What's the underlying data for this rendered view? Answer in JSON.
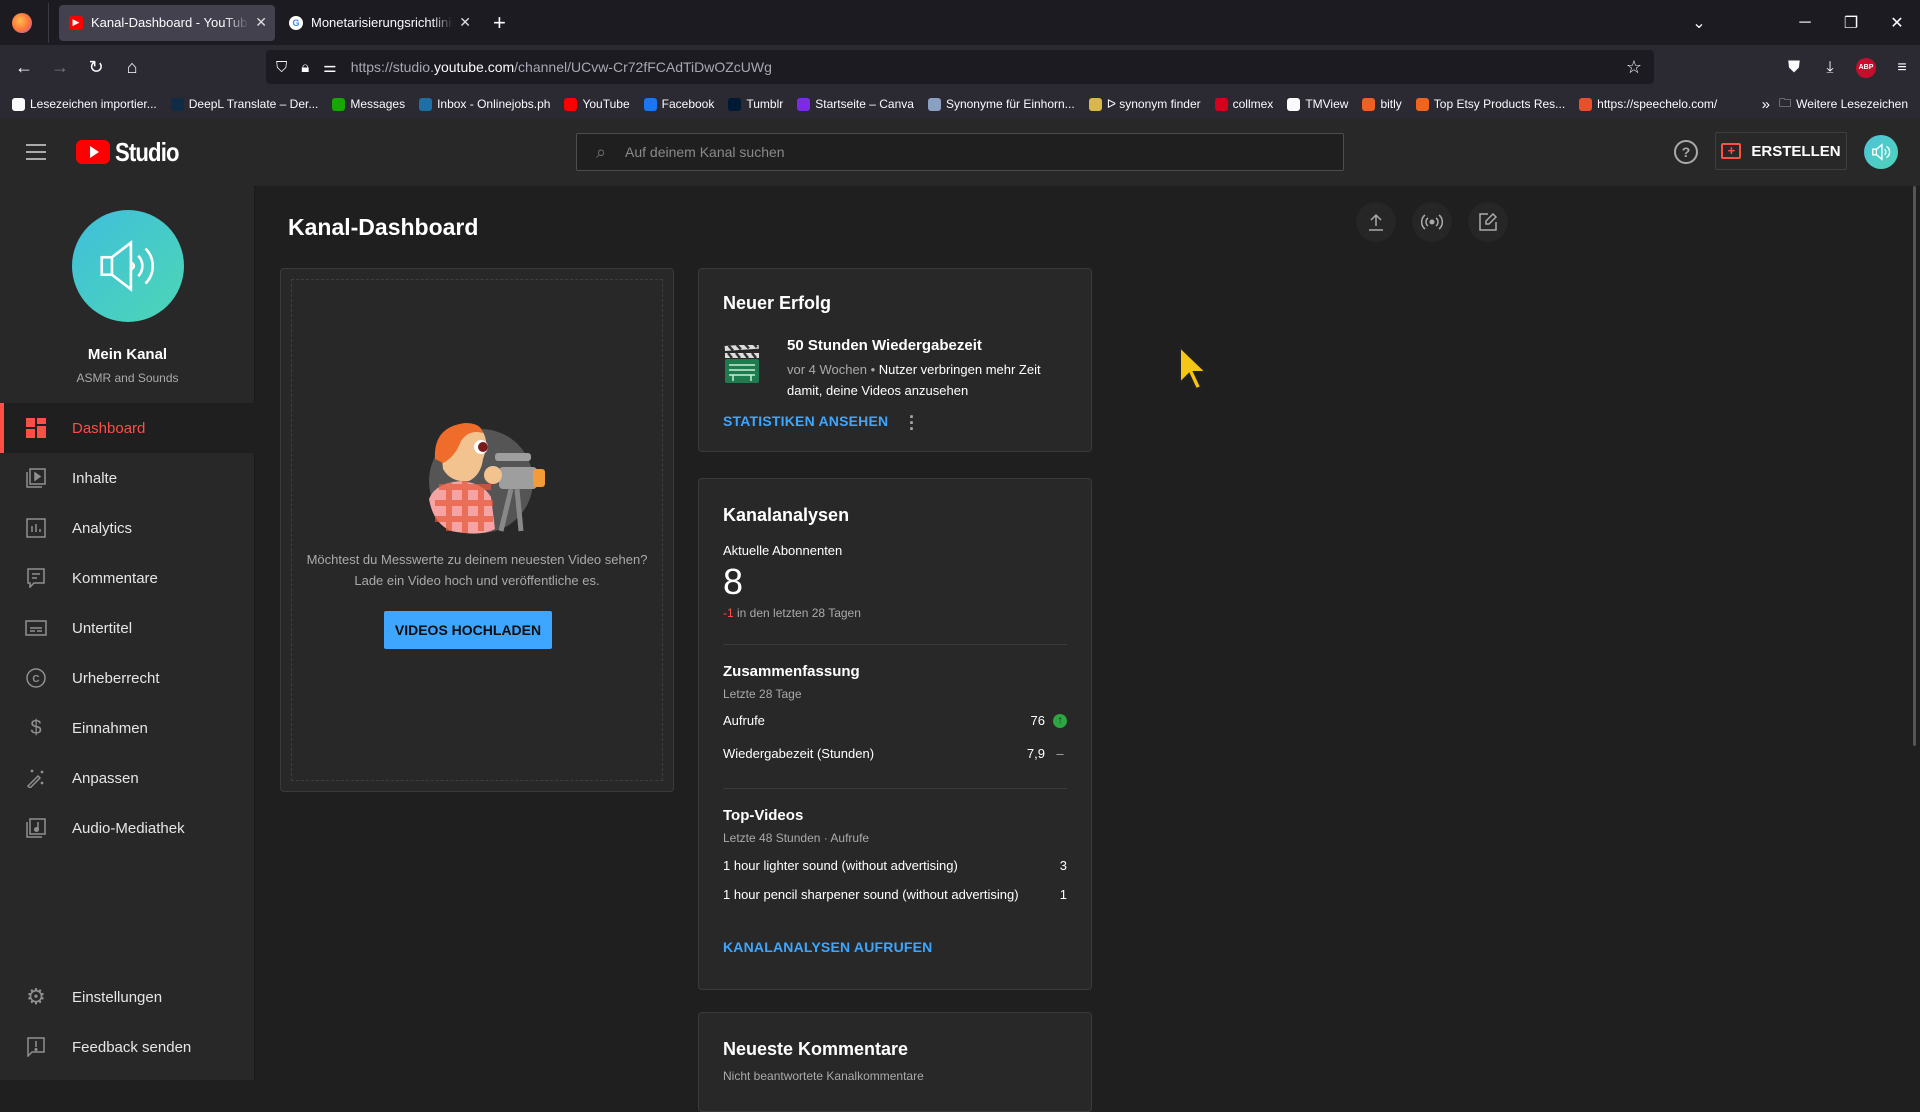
{
  "browser": {
    "tabs": [
      {
        "title": "Kanal-Dashboard - YouTube Studio",
        "favicon": "youtube-icon",
        "active": true
      },
      {
        "title": "Monetarisierungsrichtlinien von YouTube",
        "favicon": "google-icon",
        "active": false
      }
    ],
    "url": {
      "prefix": "https://studio.",
      "domain": "youtube.com",
      "path": "/channel/UCvw-Cr72fFCAdTiDwOZcUWg"
    },
    "bookmarks": [
      {
        "label": "Lesezeichen importier...",
        "icon": "import-icon",
        "color": "#fbfbfe"
      },
      {
        "label": "DeepL Translate – Der...",
        "icon": "deepl-icon",
        "color": "#0f2b46"
      },
      {
        "label": "Messages",
        "icon": "upwork-icon",
        "color": "#14a800"
      },
      {
        "label": "Inbox - Onlinejobs.ph",
        "icon": "onlinejobs-icon",
        "color": "#1d6fa5"
      },
      {
        "label": "YouTube",
        "icon": "youtube-icon",
        "color": "#ff0000"
      },
      {
        "label": "Facebook",
        "icon": "facebook-icon",
        "color": "#1877f2"
      },
      {
        "label": "Tumblr",
        "icon": "tumblr-icon",
        "color": "#001935"
      },
      {
        "label": "Startseite – Canva",
        "icon": "canva-icon",
        "color": "#7d2ae8"
      },
      {
        "label": "Synonyme für Einhorn...",
        "icon": "synonyme-icon",
        "color": "#8aa0c0"
      },
      {
        "label": "ᐅ synonym finder",
        "icon": "synonym-finder-icon",
        "color": "#d8b84a"
      },
      {
        "label": "collmex",
        "icon": "collmex-icon",
        "color": "#d6001c"
      },
      {
        "label": "TMView",
        "icon": "globe-icon",
        "color": "#fbfbfe"
      },
      {
        "label": "bitly",
        "icon": "bitly-icon",
        "color": "#ee6123"
      },
      {
        "label": "Top Etsy Products Res...",
        "icon": "etsy-icon",
        "color": "#f1641e"
      },
      {
        "label": "https://speechelo.com/",
        "icon": "speechelo-icon",
        "color": "#e8502a"
      }
    ],
    "more_bookmarks": "Weitere Lesezeichen"
  },
  "header": {
    "logo_text": "Studio",
    "search_placeholder": "Auf deinem Kanal suchen",
    "create_label": "ERSTELLEN"
  },
  "sidebar": {
    "channel_name": "Mein Kanal",
    "channel_subtitle": "ASMR and Sounds",
    "items": [
      {
        "label": "Dashboard",
        "icon": "dashboard-icon",
        "active": true
      },
      {
        "label": "Inhalte",
        "icon": "content-icon"
      },
      {
        "label": "Analytics",
        "icon": "analytics-icon"
      },
      {
        "label": "Kommentare",
        "icon": "comments-icon"
      },
      {
        "label": "Untertitel",
        "icon": "subtitles-icon"
      },
      {
        "label": "Urheberrecht",
        "icon": "copyright-icon"
      },
      {
        "label": "Einnahmen",
        "icon": "dollar-icon"
      },
      {
        "label": "Anpassen",
        "icon": "magic-wand-icon"
      },
      {
        "label": "Audio-Mediathek",
        "icon": "audio-library-icon"
      }
    ],
    "bottom_items": [
      {
        "label": "Einstellungen",
        "icon": "gear-icon"
      },
      {
        "label": "Feedback senden",
        "icon": "feedback-icon"
      }
    ]
  },
  "main": {
    "page_title": "Kanal-Dashboard",
    "upload_card": {
      "line1": "Möchtest du Messwerte zu deinem neuesten Video sehen?",
      "line2": "Lade ein Video hoch und veröffentliche es.",
      "button": "VIDEOS HOCHLADEN"
    },
    "success_card": {
      "title": "Neuer Erfolg",
      "achievement": "50 Stunden Wiedergabezeit",
      "time": "vor 4 Wochen",
      "separator": " • ",
      "description": "Nutzer verbringen mehr Zeit damit, deine Videos anzusehen",
      "link": "STATISTIKEN ANSEHEN"
    },
    "analytics_card": {
      "title": "Kanalanalysen",
      "subscribers_label": "Aktuelle Abonnenten",
      "subscribers": "8",
      "subscribers_delta": "-1",
      "subscribers_delta_text": " in den letzten 28 Tagen",
      "summary_title": "Zusammenfassung",
      "summary_period": "Letzte 28 Tage",
      "summary_rows": [
        {
          "label": "Aufrufe",
          "value": "76",
          "trend": "up"
        },
        {
          "label": "Wiedergabezeit (Stunden)",
          "value": "7,9",
          "trend": "flat"
        }
      ],
      "top_title": "Top-Videos",
      "top_period": "Letzte 48 Stunden · Aufrufe",
      "top_videos": [
        {
          "title": "1 hour lighter sound (without advertising)",
          "views": "3"
        },
        {
          "title": "1 hour pencil sharpener sound (without advertising)",
          "views": "1"
        }
      ],
      "link": "KANALANALYSEN AUFRUFEN"
    },
    "comments_card": {
      "title": "Neueste Kommentare",
      "subtitle": "Nicht beantwortete Kanalkommentare"
    }
  },
  "colors": {
    "accent_red": "#ff4e45",
    "link_blue": "#3ea6ff",
    "trend_green": "#2ba640"
  }
}
